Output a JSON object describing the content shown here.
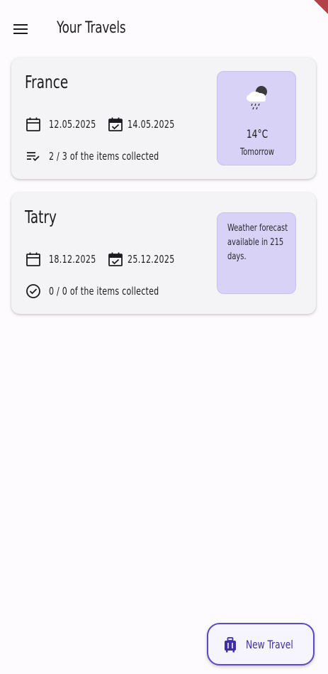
{
  "appbar": {
    "title": "Your Travels",
    "menu_icon": "menu-icon"
  },
  "travels": [
    {
      "name": "France",
      "start_date": "12.05.2025",
      "end_date": "14.05.2025",
      "start_icon": "calendar-icon",
      "end_icon": "calendar-check-icon",
      "items_icon": "checklist-icon",
      "items_text": "2 / 3 of the items collected",
      "weather": {
        "icon": "cloud-rain-icon",
        "temperature": "14°C",
        "when": "Tomorrow"
      }
    },
    {
      "name": "Tatry",
      "start_date": "18.12.2025",
      "end_date": "25.12.2025",
      "start_icon": "calendar-icon",
      "end_icon": "calendar-check-icon",
      "items_icon": "check-circle-icon",
      "items_text": "0 / 0 of the items collected",
      "weather": {
        "note": "Weather forecast available in 215 days."
      }
    }
  ],
  "fab": {
    "label": "New Travel",
    "icon": "luggage-icon"
  },
  "colors": {
    "background": "#fdfbfd",
    "card": "#f4f3f6",
    "weather_box": "#d8d2f6",
    "accent": "#5a49c9",
    "corner_banner": "#b3414a"
  }
}
